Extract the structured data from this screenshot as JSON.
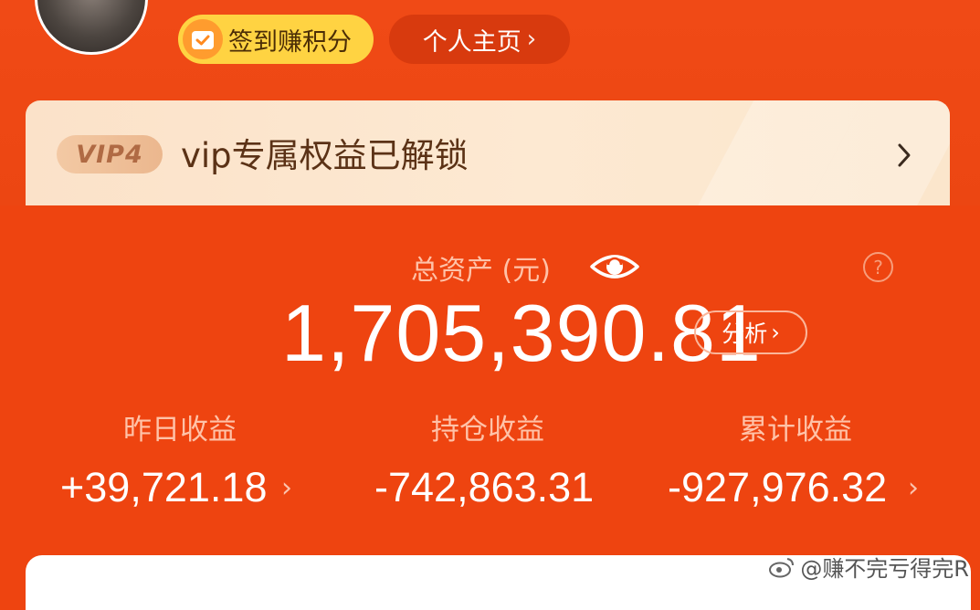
{
  "header": {
    "checkin_label": "签到赚积分",
    "profile_label": "个人主页",
    "chevron": "›"
  },
  "vip": {
    "badge": "VIP4",
    "text": "vip专属权益已解锁",
    "chevron": "›"
  },
  "assets": {
    "label": "总资产 (元)",
    "total": "1,705,390.81",
    "analyze_label": "分析",
    "help_symbol": "?",
    "stats": [
      {
        "label": "昨日收益",
        "value": "+39,721.18"
      },
      {
        "label": "持仓收益",
        "value": "-742,863.31"
      },
      {
        "label": "累计收益",
        "value": "-927,976.32"
      }
    ]
  },
  "watermark": {
    "text": "@赚不完亏得完R"
  },
  "colors": {
    "background": "#ee4410",
    "checkin_bg": "#ffd342",
    "vip_bg": "#fde9d2",
    "card_bg": "#ffffff"
  },
  "icons": {
    "checkin": "calendar-check-icon",
    "eye": "eye-icon",
    "help": "question-circle-icon",
    "vip_chevron": "chevron-right-icon",
    "watermark": "weibo-icon"
  }
}
